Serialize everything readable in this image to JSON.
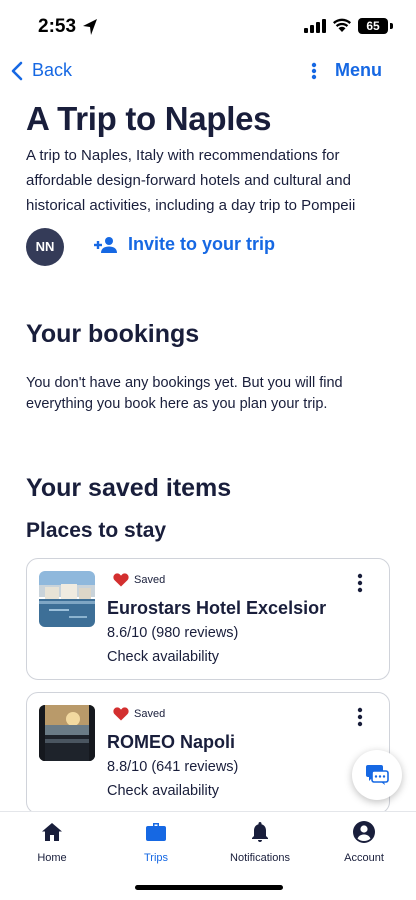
{
  "status_bar": {
    "time": "2:53",
    "battery": "65"
  },
  "nav": {
    "back_label": "Back",
    "menu_label": "Menu"
  },
  "trip": {
    "title": "A Trip to Naples",
    "description": "A trip to Naples, Italy with recommendations for affordable design-forward hotels and cultural and historical activities, including a day trip to Pompeii",
    "traveler_initials": "NN",
    "invite_label": "Invite to your trip"
  },
  "bookings": {
    "heading": "Your bookings",
    "empty_text": "You don't have any bookings yet. But you will find everything you book here as you plan your trip."
  },
  "saved": {
    "heading": "Your saved items",
    "places_heading": "Places to stay",
    "items": [
      {
        "saved_label": "Saved",
        "name": "Eurostars Hotel Excelsior",
        "rating": "8.6/10 (980 reviews)",
        "availability": "Check availability"
      },
      {
        "saved_label": "Saved",
        "name": "ROMEO Napoli",
        "rating": "8.8/10 (641 reviews)",
        "availability": "Check availability"
      }
    ]
  },
  "tabs": [
    {
      "label": "Home",
      "icon": "home-icon",
      "active": false
    },
    {
      "label": "Trips",
      "icon": "briefcase-icon",
      "active": true
    },
    {
      "label": "Notifications",
      "icon": "bell-icon",
      "active": false
    },
    {
      "label": "Account",
      "icon": "account-icon",
      "active": false
    }
  ],
  "colors": {
    "accent": "#1668e3",
    "text": "#191e3b",
    "avatar_bg": "#343b58",
    "heart": "#d32f2f"
  }
}
